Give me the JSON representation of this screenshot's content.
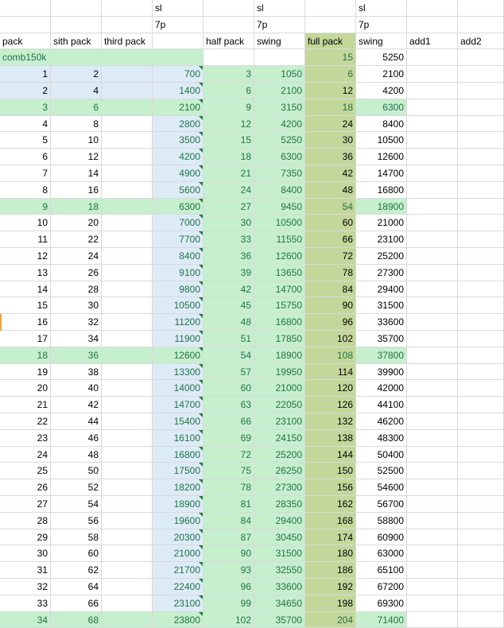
{
  "header_rows": [
    [
      "",
      "",
      "",
      "sl",
      "",
      "sl",
      "",
      "sl",
      "",
      ""
    ],
    [
      "",
      "",
      "",
      "7p",
      "",
      "7p",
      "",
      "7p",
      "",
      ""
    ],
    [
      "pack",
      "sith pack",
      "third pack",
      "",
      "half pack",
      "swing",
      "full pack",
      "swing",
      "add1",
      "add2"
    ]
  ],
  "comb_row": {
    "label": "comb150k",
    "full_pack": "15",
    "swing": "5250"
  },
  "rows": [
    [
      "1",
      "2",
      "700",
      "3",
      "1050",
      "6",
      "2100"
    ],
    [
      "2",
      "4",
      "1400",
      "6",
      "2100",
      "12",
      "4200"
    ],
    [
      "3",
      "6",
      "2100",
      "9",
      "3150",
      "18",
      "6300"
    ],
    [
      "4",
      "8",
      "2800",
      "12",
      "4200",
      "24",
      "8400"
    ],
    [
      "5",
      "10",
      "3500",
      "15",
      "5250",
      "30",
      "10500"
    ],
    [
      "6",
      "12",
      "4200",
      "18",
      "6300",
      "36",
      "12600"
    ],
    [
      "7",
      "14",
      "4900",
      "21",
      "7350",
      "42",
      "14700"
    ],
    [
      "8",
      "16",
      "5600",
      "24",
      "8400",
      "48",
      "16800"
    ],
    [
      "9",
      "18",
      "6300",
      "27",
      "9450",
      "54",
      "18900"
    ],
    [
      "10",
      "20",
      "7000",
      "30",
      "10500",
      "60",
      "21000"
    ],
    [
      "11",
      "22",
      "7700",
      "33",
      "11550",
      "66",
      "23100"
    ],
    [
      "12",
      "24",
      "8400",
      "36",
      "12600",
      "72",
      "25200"
    ],
    [
      "13",
      "26",
      "9100",
      "39",
      "13650",
      "78",
      "27300"
    ],
    [
      "14",
      "28",
      "9800",
      "42",
      "14700",
      "84",
      "29400"
    ],
    [
      "15",
      "30",
      "10500",
      "45",
      "15750",
      "90",
      "31500"
    ],
    [
      "16",
      "32",
      "11200",
      "48",
      "16800",
      "96",
      "33600"
    ],
    [
      "17",
      "34",
      "11900",
      "51",
      "17850",
      "102",
      "35700"
    ],
    [
      "18",
      "36",
      "12600",
      "54",
      "18900",
      "108",
      "37800"
    ],
    [
      "19",
      "38",
      "13300",
      "57",
      "19950",
      "114",
      "39900"
    ],
    [
      "20",
      "40",
      "14000",
      "60",
      "21000",
      "120",
      "42000"
    ],
    [
      "21",
      "42",
      "14700",
      "63",
      "22050",
      "126",
      "44100"
    ],
    [
      "22",
      "44",
      "15400",
      "66",
      "23100",
      "132",
      "46200"
    ],
    [
      "23",
      "46",
      "16100",
      "69",
      "24150",
      "138",
      "48300"
    ],
    [
      "24",
      "48",
      "16800",
      "72",
      "25200",
      "144",
      "50400"
    ],
    [
      "25",
      "50",
      "17500",
      "75",
      "26250",
      "150",
      "52500"
    ],
    [
      "26",
      "52",
      "18200",
      "78",
      "27300",
      "156",
      "54600"
    ],
    [
      "27",
      "54",
      "18900",
      "81",
      "28350",
      "162",
      "56700"
    ],
    [
      "28",
      "56",
      "19600",
      "84",
      "29400",
      "168",
      "58800"
    ],
    [
      "29",
      "58",
      "20300",
      "87",
      "30450",
      "174",
      "60900"
    ],
    [
      "30",
      "60",
      "21000",
      "90",
      "31500",
      "180",
      "63000"
    ],
    [
      "31",
      "62",
      "21700",
      "93",
      "32550",
      "186",
      "65100"
    ],
    [
      "32",
      "64",
      "22400",
      "96",
      "33600",
      "192",
      "67200"
    ],
    [
      "33",
      "66",
      "23100",
      "99",
      "34650",
      "198",
      "69300"
    ],
    [
      "34",
      "68",
      "23800",
      "102",
      "35700",
      "204",
      "71400"
    ]
  ],
  "highlight_rows": [
    3,
    9,
    18,
    34
  ],
  "colors": {
    "grid_line": "#d9d9d9",
    "blue_fill": "#ddebf7",
    "green_fill": "#c6efce",
    "olive_fill": "#c4d79b",
    "green_text": "#217346",
    "marker": "#1a7f37"
  }
}
